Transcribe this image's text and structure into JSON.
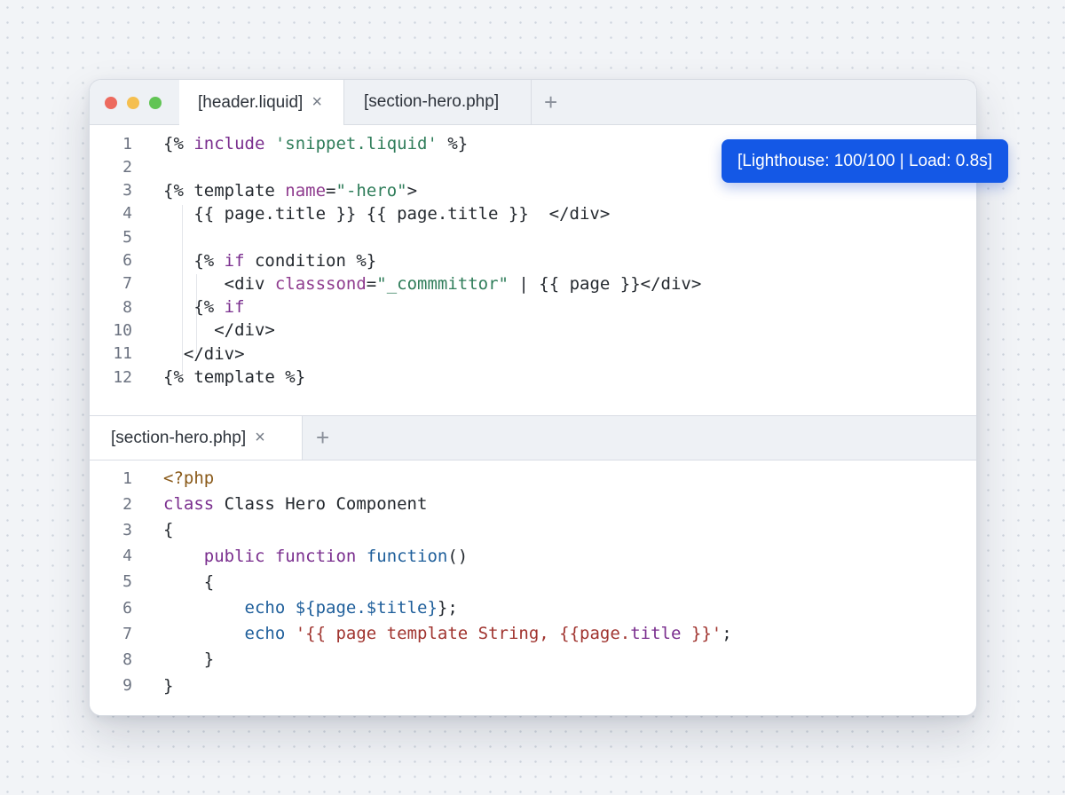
{
  "window": {
    "top_tabs": [
      {
        "label": "[header.liquid]",
        "active": true,
        "closable": true
      },
      {
        "label": "[section-hero.php]",
        "active": false,
        "closable": false
      }
    ],
    "bottom_tabs": [
      {
        "label": "[section-hero.php]",
        "active": true,
        "closable": true
      }
    ],
    "close_glyph": "×",
    "add_glyph": "+"
  },
  "badge": {
    "text": "[Lighthouse: 100/100 | Load: 0.8s]",
    "color": "#1458e6"
  },
  "liquid_code": {
    "line_numbers": [
      "1",
      "2",
      "3",
      "4",
      "5",
      "6",
      "7",
      "8",
      "10",
      "11",
      "12"
    ],
    "lines": [
      [
        {
          "t": "{% "
        },
        {
          "t": "include",
          "c": "kw"
        },
        {
          "t": " "
        },
        {
          "t": "'snippet.liquid'",
          "c": "str"
        },
        {
          "t": " %}"
        }
      ],
      [],
      [
        {
          "t": "{% template "
        },
        {
          "t": "name",
          "c": "attr"
        },
        {
          "t": "="
        },
        {
          "t": "\"-hero\"",
          "c": "str"
        },
        {
          "t": ">"
        }
      ],
      [
        {
          "t": "   {{ page.title }} {{ page.title }}  </div>"
        }
      ],
      [],
      [
        {
          "t": "   {% "
        },
        {
          "t": "if",
          "c": "kw"
        },
        {
          "t": " condition %}"
        }
      ],
      [
        {
          "t": "      <div "
        },
        {
          "t": "classsond",
          "c": "attr"
        },
        {
          "t": "="
        },
        {
          "t": "\"_commmittor\"",
          "c": "str"
        },
        {
          "t": " | {{ page }}</div>"
        }
      ],
      [
        {
          "t": "   {% "
        },
        {
          "t": "if",
          "c": "kw"
        }
      ],
      [
        {
          "t": "     </div>"
        }
      ],
      [
        {
          "t": "  </div>"
        }
      ],
      [
        {
          "t": "{% template %}"
        }
      ]
    ]
  },
  "php_code": {
    "line_numbers": [
      "1",
      "2",
      "3",
      "4",
      "5",
      "6",
      "7",
      "8",
      "9"
    ],
    "lines": [
      [
        {
          "t": "<?php",
          "c": "php"
        }
      ],
      [
        {
          "t": "class",
          "c": "kw"
        },
        {
          "t": " Class Hero Component"
        }
      ],
      [
        {
          "t": "{"
        }
      ],
      [
        {
          "t": "    "
        },
        {
          "t": "public function",
          "c": "kw"
        },
        {
          "t": " "
        },
        {
          "t": "function",
          "c": "fn"
        },
        {
          "t": "()"
        }
      ],
      [
        {
          "t": "    {"
        }
      ],
      [
        {
          "t": "        "
        },
        {
          "t": "echo",
          "c": "fn"
        },
        {
          "t": " "
        },
        {
          "t": "${page.$title}",
          "c": "var"
        },
        {
          "t": "};"
        }
      ],
      [
        {
          "t": "        "
        },
        {
          "t": "echo",
          "c": "fn"
        },
        {
          "t": " "
        },
        {
          "t": "'{{ page template String, {{page.",
          "c": "str2"
        },
        {
          "t": "title",
          "c": "kw"
        },
        {
          "t": " }}'",
          "c": "str2"
        },
        {
          "t": ";"
        }
      ],
      [
        {
          "t": "    }"
        }
      ],
      [
        {
          "t": "}"
        }
      ]
    ]
  }
}
